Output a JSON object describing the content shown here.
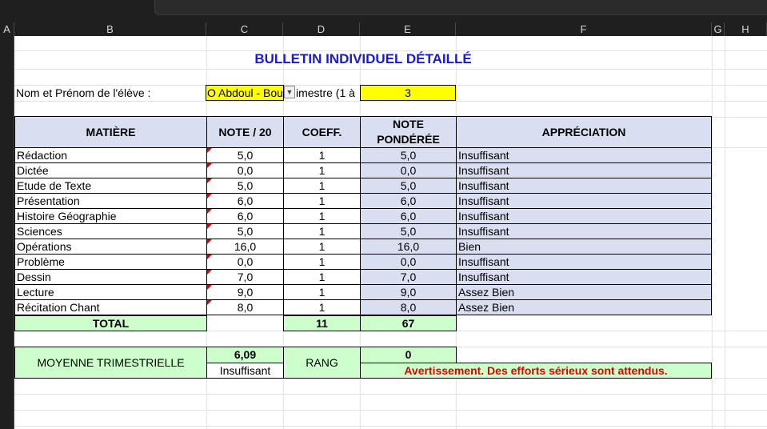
{
  "columns": [
    "A",
    "B",
    "C",
    "D",
    "E",
    "F",
    "G",
    "H"
  ],
  "title": "BULLETIN INDIVIDUEL DÉTAILLÉ",
  "student_label": "Nom et Prénom de l'élève :",
  "student_name": "O Abdoul - Bou",
  "trimester_label": "imestre (1 à",
  "trimester_value": "3",
  "headers": {
    "matiere": "MATIÈRE",
    "note": "NOTE / 20",
    "coeff": "COEFF.",
    "note_ponderee": "NOTE\nPONDÉRÉE",
    "appreciation": "APPRÉCIATION"
  },
  "rows": [
    {
      "matiere": "Rédaction",
      "note": "5,0",
      "coeff": "1",
      "ponderee": "5,0",
      "appreciation": "Insuffisant"
    },
    {
      "matiere": "Dictée",
      "note": "0,0",
      "coeff": "1",
      "ponderee": "0,0",
      "appreciation": "Insuffisant"
    },
    {
      "matiere": "Etude de Texte",
      "note": "5,0",
      "coeff": "1",
      "ponderee": "5,0",
      "appreciation": "Insuffisant"
    },
    {
      "matiere": "Présentation",
      "note": "6,0",
      "coeff": "1",
      "ponderee": "6,0",
      "appreciation": "Insuffisant"
    },
    {
      "matiere": "Histoire Géographie",
      "note": "6,0",
      "coeff": "1",
      "ponderee": "6,0",
      "appreciation": "Insuffisant"
    },
    {
      "matiere": "Sciences",
      "note": "5,0",
      "coeff": "1",
      "ponderee": "5,0",
      "appreciation": "Insuffisant"
    },
    {
      "matiere": "Opérations",
      "note": "16,0",
      "coeff": "1",
      "ponderee": "16,0",
      "appreciation": "Bien"
    },
    {
      "matiere": "Problème",
      "note": "0,0",
      "coeff": "1",
      "ponderee": "0,0",
      "appreciation": "Insuffisant"
    },
    {
      "matiere": "Dessin",
      "note": "7,0",
      "coeff": "1",
      "ponderee": "7,0",
      "appreciation": "Insuffisant"
    },
    {
      "matiere": "Lecture",
      "note": "9,0",
      "coeff": "1",
      "ponderee": "9,0",
      "appreciation": "Assez Bien"
    },
    {
      "matiere": "Récitation Chant",
      "note": "8,0",
      "coeff": "1",
      "ponderee": "8,0",
      "appreciation": "Assez Bien"
    }
  ],
  "total": {
    "label": "TOTAL",
    "coeff": "11",
    "ponderee": "67"
  },
  "moyenne": {
    "label": "MOYENNE TRIMESTRIELLE",
    "value": "6,09",
    "appreciation": "Insuffisant"
  },
  "rang": {
    "label": "RANG",
    "value": "0",
    "message": "Avertissement. Des efforts sérieux sont attendus."
  },
  "colors": {
    "title": "#1a1ad6",
    "header_bg": "#d9dff0",
    "green": "#ccffcc",
    "yellow": "#ffff00",
    "warning": "#e00000"
  }
}
